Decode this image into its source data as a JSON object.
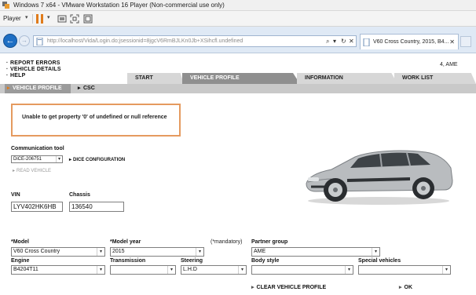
{
  "vmware": {
    "window_title": "Windows 7 x64 - VMware Workstation 16 Player (Non-commercial use only)",
    "menu_label": "Player",
    "accent_color": "#e07b1a"
  },
  "browser": {
    "url": "http://localhost/Vida/Login.do;jsessionid=8jgcV6RmBJLKn0Jb+XSihcfl.undefined",
    "tab_title": "V60 Cross Country, 2015, B4...",
    "icons": [
      "back-arrow-icon",
      "forward-arrow-icon",
      "search-icon",
      "refresh-icon",
      "close-icon",
      "new-tab-icon"
    ]
  },
  "page": {
    "top_menu": [
      "REPORT ERRORS",
      "VEHICLE DETAILS",
      "HELP"
    ],
    "user": "4, AME",
    "tabs": [
      "START",
      "VEHICLE PROFILE",
      "INFORMATION",
      "WORK LIST"
    ],
    "active_tab": "VEHICLE PROFILE",
    "subtabs": [
      "VEHICLE PROFILE",
      "CSC"
    ],
    "error_message": "Unable to get property '0' of undefined or null reference",
    "comm_tool": {
      "label": "Communication tool",
      "value": "DiCE-206751",
      "dice_config": "DICE CONFIGURATION",
      "read_vehicle": "READ VEHICLE"
    },
    "vin": {
      "label": "VIN",
      "value": "LYV402HK6HB"
    },
    "chassis": {
      "label": "Chassis",
      "value": "136540"
    },
    "mandatory_note": "(*mandatory)",
    "model": {
      "label": "*Model",
      "value": "V60 Cross Country"
    },
    "model_year": {
      "label": "*Model year",
      "value": "2015"
    },
    "partner_group": {
      "label": "Partner group",
      "value": "AME"
    },
    "engine": {
      "label": "Engine",
      "value": "B4204T11"
    },
    "transmission": {
      "label": "Transmission",
      "value": ""
    },
    "steering": {
      "label": "Steering",
      "value": "L.H.D"
    },
    "body_style": {
      "label": "Body style",
      "value": ""
    },
    "special_vehicles": {
      "label": "Special vehicles",
      "value": ""
    },
    "clear_button": "CLEAR VEHICLE PROFILE",
    "ok_button": "OK"
  }
}
